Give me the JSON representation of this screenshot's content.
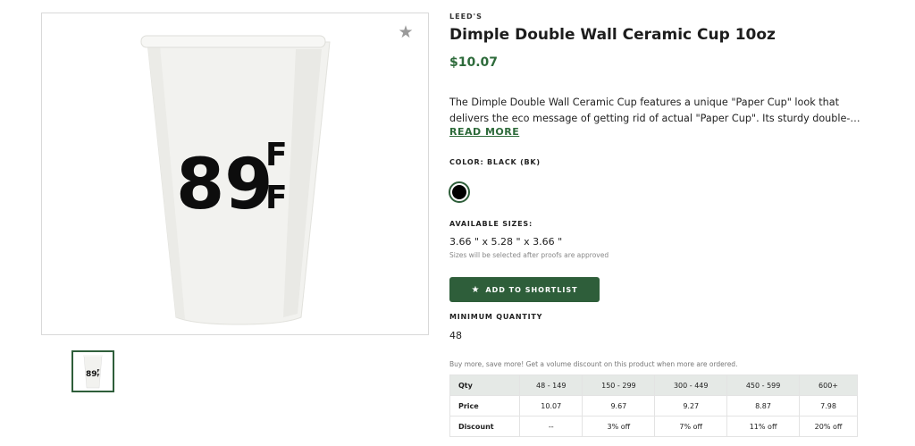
{
  "product": {
    "brand": "LEED'S",
    "title": "Dimple Double Wall Ceramic Cup 10oz",
    "price": "$10.07",
    "description_line1": "The Dimple Double Wall Ceramic Cup features a unique \"Paper Cup\" look that",
    "description_line2": "delivers the eco message of getting rid of actual \"Paper Cup\". Its sturdy double-wal...",
    "read_more": "READ MORE"
  },
  "image": {
    "logo_text": "89",
    "logo_letters": [
      "F",
      "F"
    ],
    "thumb_logo_text": "89"
  },
  "color": {
    "label": "COLOR: BLACK (BK)",
    "swatch_color": "#000000"
  },
  "sizes": {
    "label": "AVAILABLE SIZES:",
    "value": "3.66 \" x 5.28 \" x 3.66 \"",
    "note": "Sizes will be selected after proofs are approved"
  },
  "actions": {
    "shortlist_label": "ADD TO SHORTLIST"
  },
  "minimum": {
    "label": "MINIMUM QUANTITY",
    "value": "48"
  },
  "volume": {
    "note": "Buy more, save more! Get a volume discount on this product when more are ordered."
  },
  "pricing_table": {
    "headers": [
      "Qty",
      "48 - 149",
      "150 - 299",
      "300 - 449",
      "450 - 599",
      "600+"
    ],
    "rows": [
      [
        "Price",
        "10.07",
        "9.67",
        "9.27",
        "8.87",
        "7.98"
      ],
      [
        "Discount",
        "--",
        "3% off",
        "7% off",
        "11% off",
        "20% off"
      ]
    ]
  },
  "colors": {
    "accent": "#2e5e3a",
    "price": "#2e6b3b"
  }
}
